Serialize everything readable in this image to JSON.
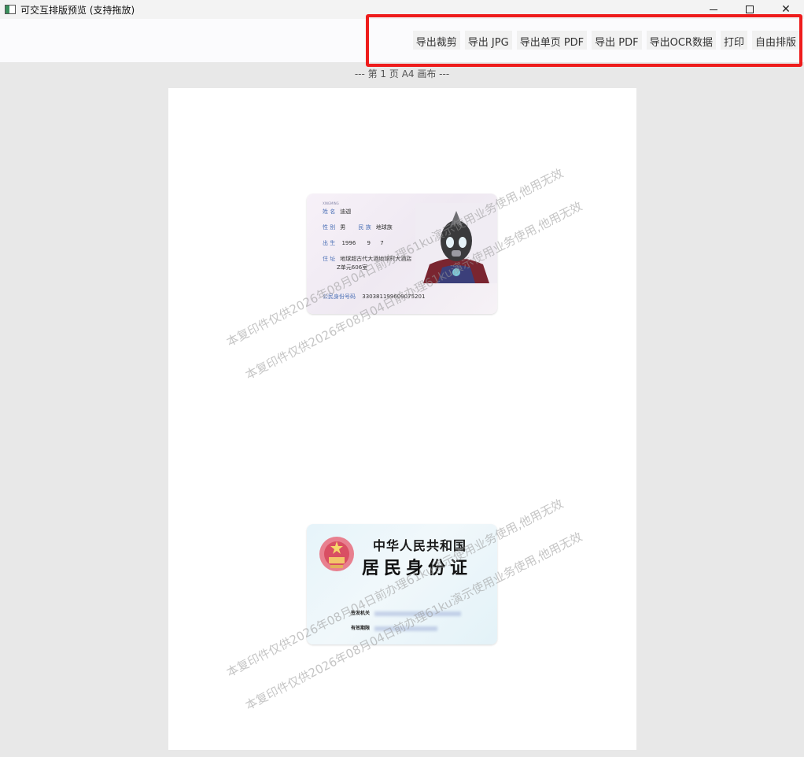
{
  "window": {
    "title": "可交互排版预览 (支持拖放)",
    "controls": {
      "close": "✕"
    }
  },
  "toolbar": {
    "buttons": [
      "导出裁剪",
      "导出 JPG",
      "导出单页 PDF",
      "导出 PDF",
      "导出OCR数据",
      "打印",
      "自由排版"
    ]
  },
  "canvas": {
    "label": "--- 第 1 页 A4 画布 ---"
  },
  "watermark": {
    "line1": "本复印件仅供2026年08月04日前办理61ku演示使用业务使用,他用无效",
    "line2": "本复印件仅供2026年08月04日前办理61ku演示使用业务使用,他用无效"
  },
  "id_front": {
    "name_label": "姓 名",
    "name_value": "迪迦",
    "sex_label": "性 别",
    "sex_value": "男",
    "ethnic_label": "民 族",
    "ethnic_value": "地球族",
    "birth_label": "出 生",
    "birth_year": "1996",
    "birth_month": "9",
    "birth_day": "7",
    "address_label": "住 址",
    "address_line1": "地球超古代大酒地球村大酒店",
    "address_line2": "Z单元606室",
    "id_label": "公民身份号码",
    "id_number": "330381199609075201"
  },
  "id_back": {
    "title1": "中华人民共和国",
    "title2": "居民身份证",
    "authority_label": "签发机关",
    "validity_label": "有效期限"
  }
}
